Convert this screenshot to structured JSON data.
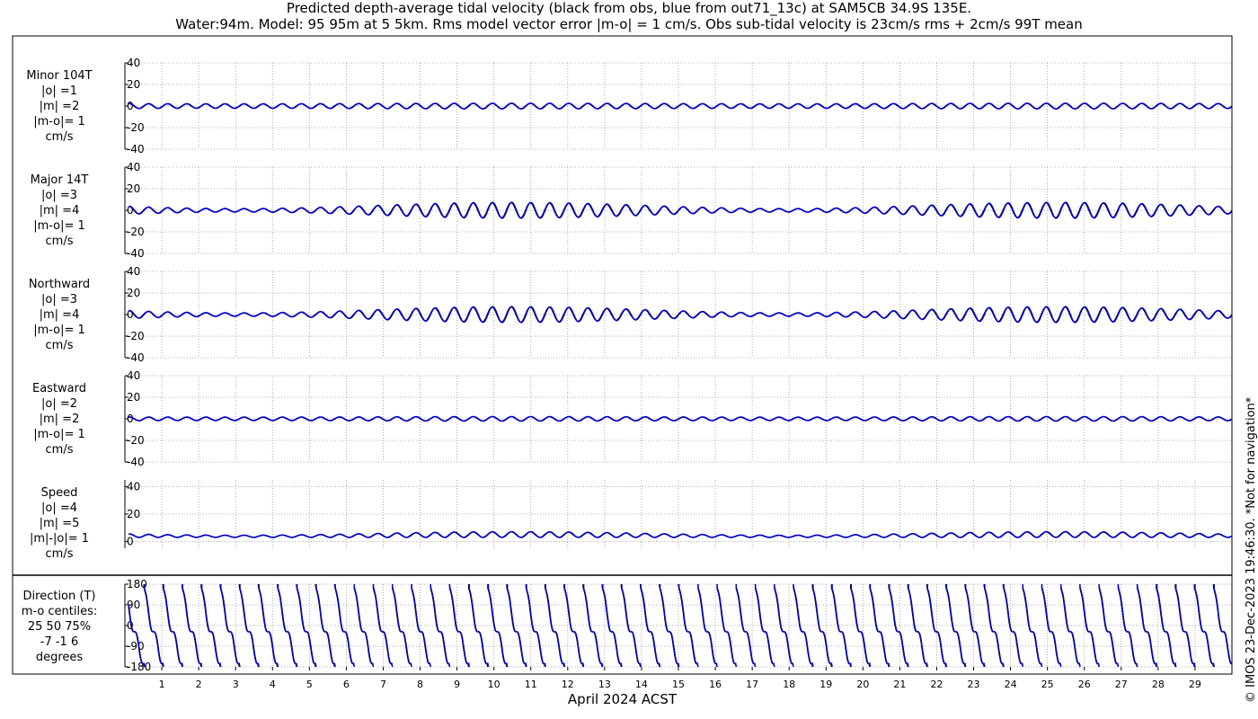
{
  "title_line1": "Predicted depth-average tidal velocity (black from obs, blue from out71_13c) at SAM5CB 34.9S 135E.",
  "title_line2": "Water:94m. Model: 95 95m at 5 5km. Rms model vector error |m-o| = 1 cm/s. Obs sub-tidal velocity is 23cm/s rms + 2cm/s 99T mean",
  "xlabel": "April 2024 ACST",
  "copyright": "© IMOS 23-Dec-2023 19:46:30. *Not for navigation*",
  "colors": {
    "obs": "#000000",
    "model": "#0000cc",
    "grid": "#999999"
  },
  "chart_data": {
    "type": "line",
    "x_ticks": [
      "1",
      "2",
      "3",
      "4",
      "5",
      "6",
      "7",
      "8",
      "9",
      "10",
      "11",
      "12",
      "13",
      "14",
      "15",
      "16",
      "17",
      "18",
      "19",
      "20",
      "21",
      "22",
      "23",
      "24",
      "25",
      "26",
      "27",
      "28",
      "29"
    ],
    "xlim": [
      0,
      30
    ],
    "grid": true,
    "series_names": [
      "obs",
      "out71_13c"
    ],
    "panels": [
      {
        "name": "minor",
        "label": "Minor 104T\n|o| =1\n|m| =2\n|m-o|= 1\ncm/s",
        "ylim": [
          -40,
          40
        ],
        "yticks": [
          "40",
          "20",
          "0",
          "-20",
          "-40"
        ],
        "tickvals": [
          40,
          20,
          0,
          -20,
          -40
        ],
        "amplitude": [
          2,
          2.5
        ],
        "offset": 0
      },
      {
        "name": "major",
        "label": "Major 14T\n|o| =3\n|m| =4\n|m-o|= 1\ncm/s",
        "ylim": [
          -40,
          40
        ],
        "yticks": [
          "40",
          "20",
          "0",
          "-20",
          "-40"
        ],
        "tickvals": [
          40,
          20,
          0,
          -20,
          -40
        ],
        "amplitude": [
          1.5,
          7
        ],
        "offset": 0
      },
      {
        "name": "northward",
        "label": "Northward\n|o| =3\n|m| =4\n|m-o|= 1\ncm/s",
        "ylim": [
          -40,
          40
        ],
        "yticks": [
          "40",
          "20",
          "0",
          "-20",
          "-40"
        ],
        "tickvals": [
          40,
          20,
          0,
          -20,
          -40
        ],
        "amplitude": [
          1.5,
          7
        ],
        "offset": 0
      },
      {
        "name": "eastward",
        "label": "Eastward\n|o| =2\n|m| =2\n|m-o|= 1\ncm/s",
        "ylim": [
          -40,
          40
        ],
        "yticks": [
          "40",
          "20",
          "0",
          "-20",
          "-40"
        ],
        "tickvals": [
          40,
          20,
          0,
          -20,
          -40
        ],
        "amplitude": [
          1.5,
          2
        ],
        "offset": 0
      },
      {
        "name": "speed",
        "label": "Speed\n|o| =4\n|m| =5\n|m|-|o|= 1\ncm/s",
        "ylim": [
          -5,
          45
        ],
        "yticks": [
          "40",
          "20",
          "0"
        ],
        "tickvals": [
          40,
          20,
          0
        ],
        "amplitude": [
          1.5,
          4
        ],
        "offset": 3
      },
      {
        "name": "direction",
        "label": "Direction (T)\nm-o centiles:\n25  50  75%\n-7 -1  6\ndegrees",
        "ylim": [
          -180,
          180
        ],
        "yticks": [
          "180",
          "90",
          "0",
          "-90",
          "-180"
        ],
        "tickvals": [
          180,
          90,
          0,
          -90,
          -180
        ],
        "type": "direction"
      }
    ]
  }
}
